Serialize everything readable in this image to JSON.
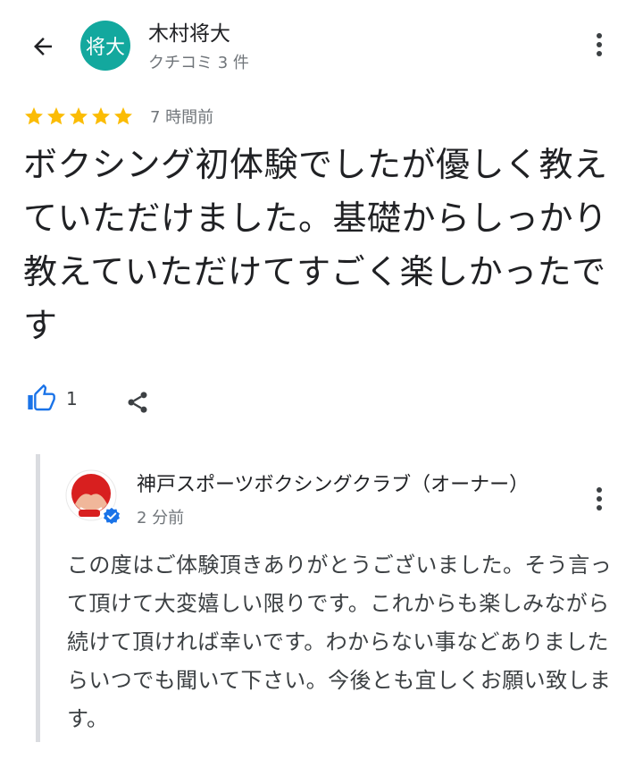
{
  "header": {
    "avatar_text": "将大",
    "reviewer_name": "木村将大",
    "review_count": "クチコミ 3 件"
  },
  "rating": {
    "stars": 5,
    "max_stars": 5,
    "time_ago": "7 時間前",
    "star_color": "#fbbc04"
  },
  "review": {
    "text": "ボクシング初体験でしたが優しく教えていただけました。基礎からしっかり教えていただけてすごく楽しかったです"
  },
  "actions": {
    "like_count": "1",
    "like_icon": "thumbs-up-icon",
    "share_icon": "share-icon",
    "accent_color": "#1a73e8"
  },
  "owner_reply": {
    "name": "神戸スポーツボクシングクラブ（オーナー）",
    "time_ago": "2 分前",
    "text": "この度はご体験頂きありがとうございました。そう言って頂けて大変嬉しい限りです。これからも楽しみながら続けて頂ければ幸いです。わからない事などありましたらいつでも聞いて下さい。今後とも宜しくお願い致します。",
    "avatar_brand_color": "#d81f1f",
    "verified_color": "#1a73e8"
  }
}
